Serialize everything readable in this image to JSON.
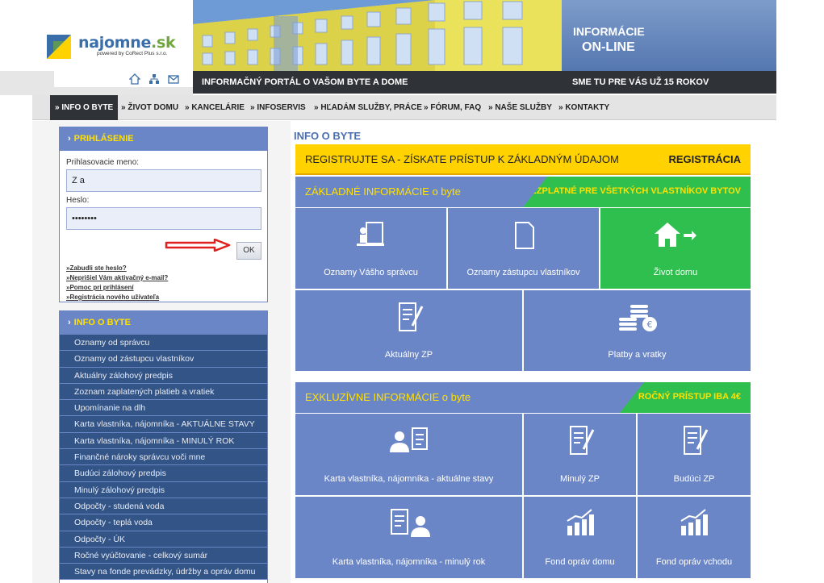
{
  "header": {
    "logo_name": "najomne",
    "logo_tld": ".sk",
    "logo_sub": "powered by CoRect Plus s.r.o.",
    "info_line1": "INFORMÁCIE",
    "info_line2": "ON-LINE",
    "band_left": "INFORMAČNÝ PORTÁL O VAŠOM BYTE A DOME",
    "band_right": "SME TU PRE VÁS UŽ 15 ROKOV",
    "icons": [
      "home-icon",
      "sitemap-icon",
      "mail-icon"
    ]
  },
  "nav": {
    "items": [
      "» INFO O BYTE",
      "» ŽIVOT DOMU",
      "» KANCELÁRIE",
      "» INFOSERVIS",
      "» HĽADÁM SLUŽBY, PRÁCE",
      "» FÓRUM, FAQ",
      "» NAŠE SLUŽBY",
      "» KONTAKTY"
    ]
  },
  "login": {
    "title": "PRIHLÁSENIE",
    "username_label": "Prihlasovacie meno:",
    "username_value": "Z a",
    "password_label": "Heslo:",
    "password_value": "••••••••",
    "ok_label": "OK",
    "links": [
      "Zabudli ste heslo?",
      "Neprišiel Vám aktivačný e-mail?",
      "Pomoc pri prihlásení",
      "Registrácia nového užívateľa"
    ]
  },
  "menu": {
    "title": "INFO O BYTE",
    "items": [
      "Oznamy od správcu",
      "Oznamy od zástupcu vlastníkov",
      "Aktuálny zálohový predpis",
      "Zoznam zaplatených platieb a vratiek",
      "Upomínanie na dlh",
      "Karta vlastníka, nájomníka - AKTUÁLNE STAVY",
      "Karta vlastníka, nájomníka - MINULÝ ROK",
      "Finančné nároky správcu voči mne",
      "Budúci zálohový predpis",
      "Minulý zálohový predpis",
      "Odpočty - studená voda",
      "Odpočty - teplá voda",
      "Odpočty - ÚK",
      "Ročné vyúčtovanie - celkový sumár",
      "Stavy na fonde prevádzky, údržby a opráv domu"
    ]
  },
  "main": {
    "title": "INFO O BYTE",
    "register_text": "REGISTRUJTE SA - ZÍSKATE PRÍSTUP K ZÁKLADNÝM ÚDAJOM",
    "register_link": "REGISTRÁCIA",
    "basic_title": "ZÁKLADNÉ INFORMÁCIE o byte",
    "basic_tag": "BEZPLATNÉ PRE VŠETKÝCH VLASTNÍKOV BYTOV",
    "exclusive_title": "EXKLUZÍVNE INFORMÁCIE o byte",
    "exclusive_tag": "ROČNÝ PRÍSTUP IBA 4€",
    "basic_tiles": [
      "Oznamy Vášho správcu",
      "Oznamy zástupcu vlastníkov",
      "Život domu",
      "Aktuálny ZP",
      "Platby a vratky"
    ],
    "exclusive_tiles": [
      "Karta vlastníka, nájomníka - aktuálne stavy",
      "Minulý ZP",
      "Budúci ZP",
      "Karta vlastníka, nájomníka - minulý rok",
      "Fond opráv domu",
      "Fond opráv vchodu"
    ]
  },
  "colors": {
    "panel_blue": "#6b86c6",
    "menu_dark": "#335487",
    "accent_yellow": "#ffd200",
    "accent_green": "#2fbf4f",
    "dark_band": "#2f3338"
  }
}
